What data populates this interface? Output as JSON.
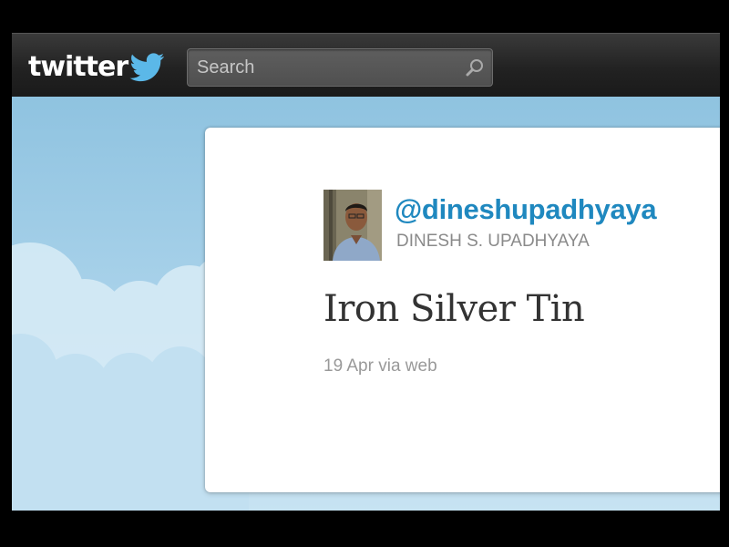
{
  "header": {
    "logo_text": "twitter",
    "logo_icon": "twitter-bird-icon",
    "search": {
      "placeholder": "Search",
      "value": "",
      "icon": "search-icon"
    }
  },
  "tweet": {
    "avatar_icon": "user-avatar",
    "handle": "@dineshupadhyaya",
    "full_name": "DINESH S. UPADHYAYA",
    "text": "Iron Silver Tin",
    "timestamp": "19 Apr",
    "via_prefix": "via",
    "source": "web"
  },
  "colors": {
    "topbar": "#222222",
    "sky": "#a9d2ea",
    "handle": "#1f88bf",
    "bird": "#5bb8e8"
  }
}
